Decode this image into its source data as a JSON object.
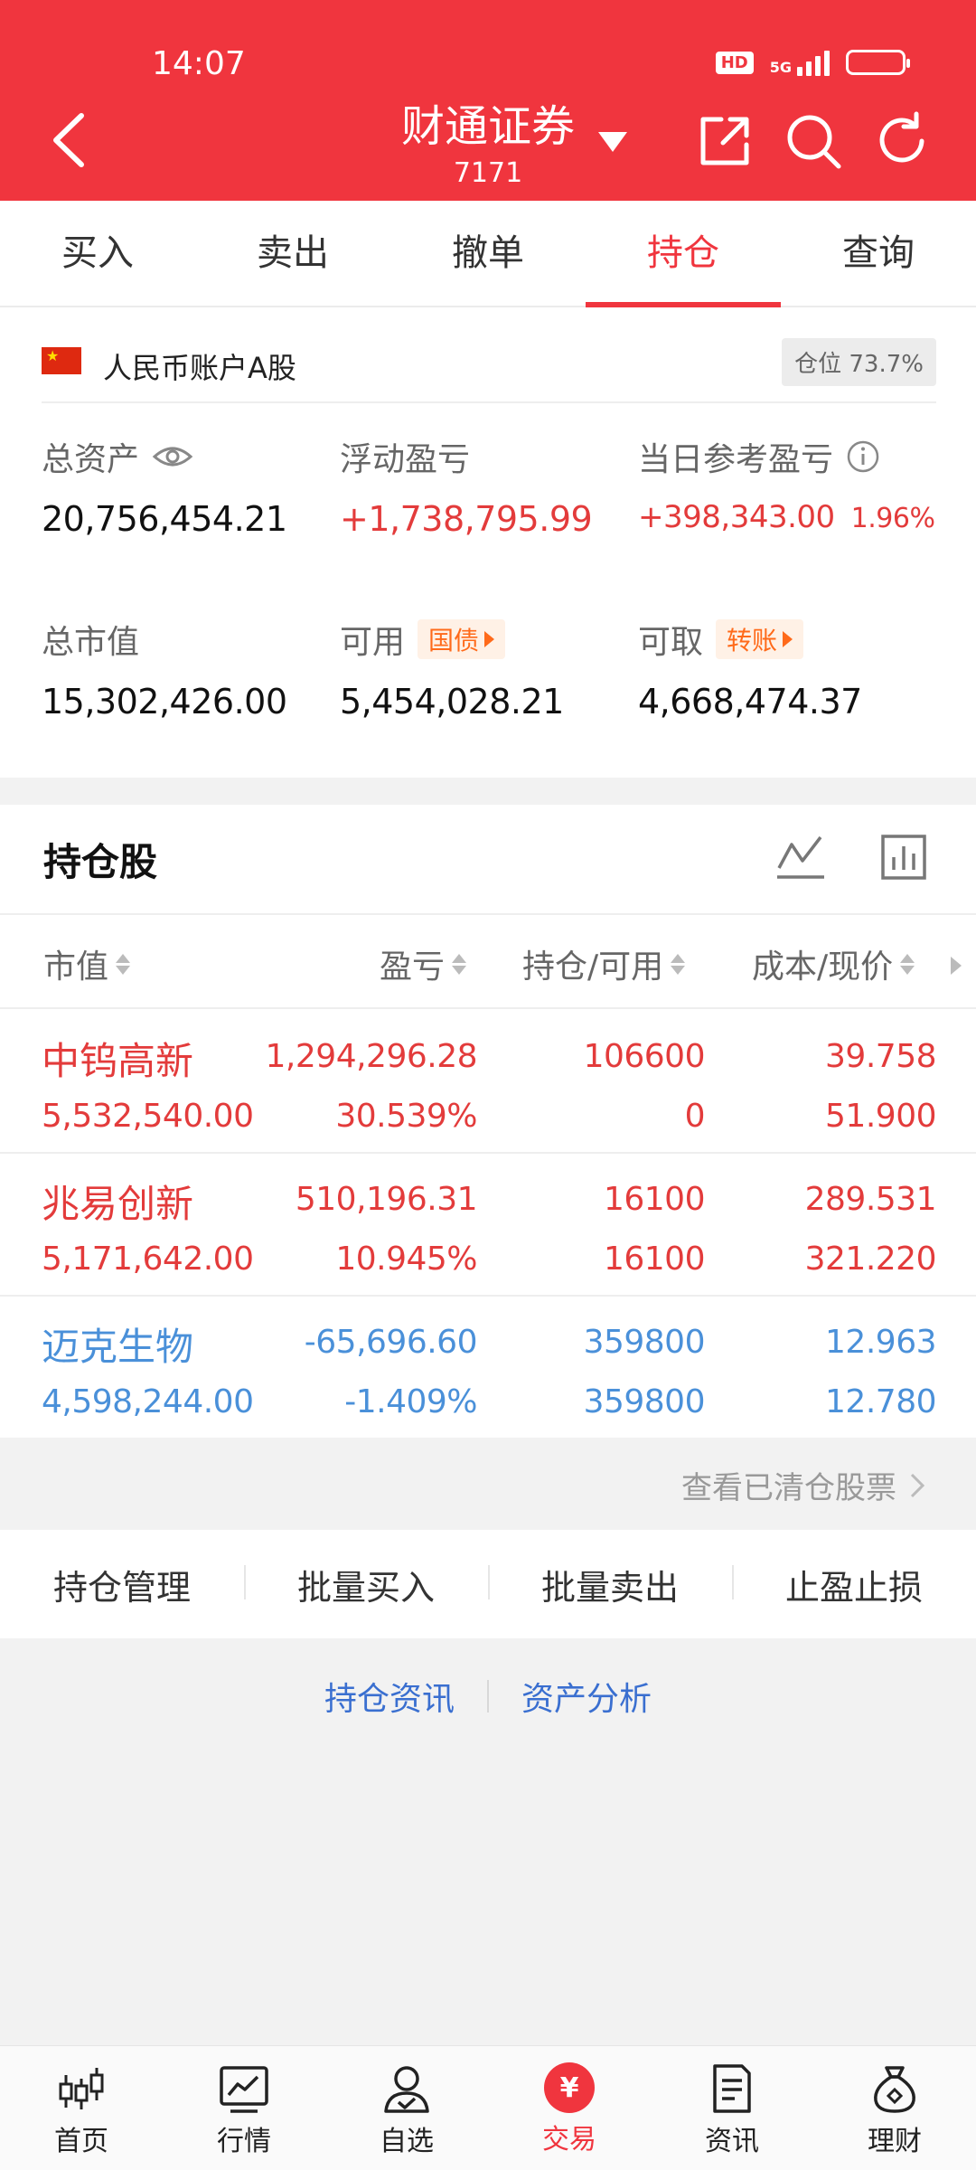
{
  "status": {
    "time": "14:07",
    "hd": "HD",
    "network": "5G"
  },
  "header": {
    "title": "财通证券",
    "subtitle": "7171"
  },
  "tabs": [
    "买入",
    "卖出",
    "撤单",
    "持仓",
    "查询"
  ],
  "account": {
    "name": "人民币账户A股",
    "position": "仓位 73.7%",
    "total_assets_label": "总资产",
    "total_assets": "20,756,454.21",
    "floating_pnl_label": "浮动盈亏",
    "floating_pnl": "+1,738,795.99",
    "today_pnl_label": "当日参考盈亏",
    "today_pnl": "+398,343.00",
    "today_pnl_pct": "1.96%",
    "market_value_label": "总市值",
    "market_value": "15,302,426.00",
    "available_label": "可用",
    "available_tag": "国债",
    "available": "5,454,028.21",
    "withdrawable_label": "可取",
    "withdrawable_tag": "转账",
    "withdrawable": "4,668,474.37"
  },
  "holdings": {
    "title": "持仓股",
    "columns": [
      "市值",
      "盈亏",
      "持仓/可用",
      "成本/现价"
    ],
    "rows": [
      {
        "name": "中钨高新",
        "market_value": "5,532,540.00",
        "pnl": "1,294,296.28",
        "pnl_pct": "30.539%",
        "holding": "106600",
        "available": "0",
        "cost": "39.758",
        "price": "51.900",
        "color": "#e33b3b"
      },
      {
        "name": "兆易创新",
        "market_value": "5,171,642.00",
        "pnl": "510,196.31",
        "pnl_pct": "10.945%",
        "holding": "16100",
        "available": "16100",
        "cost": "289.531",
        "price": "321.220",
        "color": "#e33b3b"
      },
      {
        "name": "迈克生物",
        "market_value": "4,598,244.00",
        "pnl": "-65,696.60",
        "pnl_pct": "-1.409%",
        "holding": "359800",
        "available": "359800",
        "cost": "12.963",
        "price": "12.780",
        "color": "#4a90d9"
      }
    ],
    "cleared_link": "查看已清仓股票"
  },
  "actions": [
    "持仓管理",
    "批量买入",
    "批量卖出",
    "止盈止损"
  ],
  "footer_links": [
    "持仓资讯",
    "资产分析"
  ],
  "nav": {
    "items": [
      "首页",
      "行情",
      "自选",
      "交易",
      "资讯",
      "理财"
    ],
    "trade_symbol": "¥"
  },
  "colors": {
    "brand": "#f0353e",
    "up": "#e33b3b",
    "down": "#4a90d9",
    "tag": "#ff6a1a"
  }
}
